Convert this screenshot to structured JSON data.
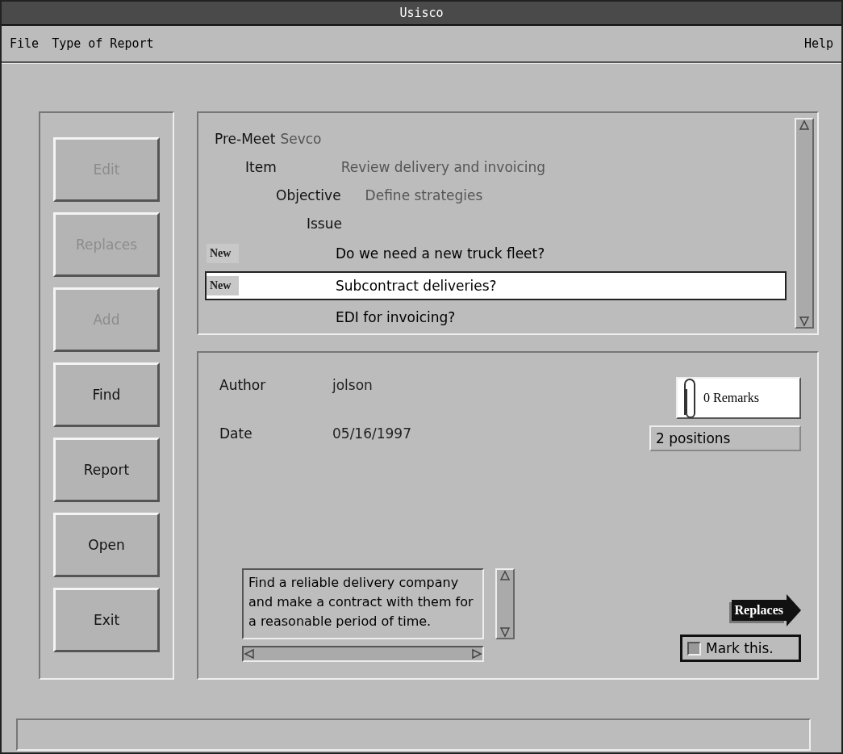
{
  "window": {
    "title": "Usisco"
  },
  "menu": [
    {
      "label": "File"
    },
    {
      "label": "Type of Report"
    },
    {
      "label": "Help"
    }
  ],
  "sidebar": {
    "buttons": [
      {
        "label": "Edit",
        "disabled": true
      },
      {
        "label": "Replaces",
        "disabled": true
      },
      {
        "label": "Add",
        "disabled": true
      },
      {
        "label": "Find",
        "disabled": false
      },
      {
        "label": "Report",
        "disabled": false
      },
      {
        "label": "Open",
        "disabled": false
      },
      {
        "label": "Exit",
        "disabled": false
      }
    ]
  },
  "tree": [
    {
      "label": "Pre-Meet",
      "value": "Sevco",
      "children": [
        {
          "label": "Item",
          "value": "Review delivery and invoicing",
          "children": [
            {
              "label": "Objective",
              "value": "Define strategies",
              "children": [
                {
                  "label": "Issue",
                  "children": [
                    {
                      "label": "Do we need a new truck fleet?",
                      "badge": "New",
                      "selected": false
                    },
                    {
                      "label": "Subcontract deliveries?",
                      "badge": "New",
                      "selected": true
                    },
                    {
                      "label": "EDI for invoicing?",
                      "selected": false
                    }
                  ]
                }
              ]
            }
          ]
        }
      ]
    }
  ],
  "details": {
    "fields": [
      {
        "label": "Author",
        "value": "jolson"
      },
      {
        "label": "Date",
        "value": "05/16/1997"
      }
    ],
    "remarks": "0 Remarks",
    "positions": "2 positions",
    "description": "Find a reliable delivery company and make a contract with them for a reasonable period of time.",
    "replaces": "Replaces",
    "mark": {
      "label": "Mark this.",
      "checked": false
    }
  }
}
